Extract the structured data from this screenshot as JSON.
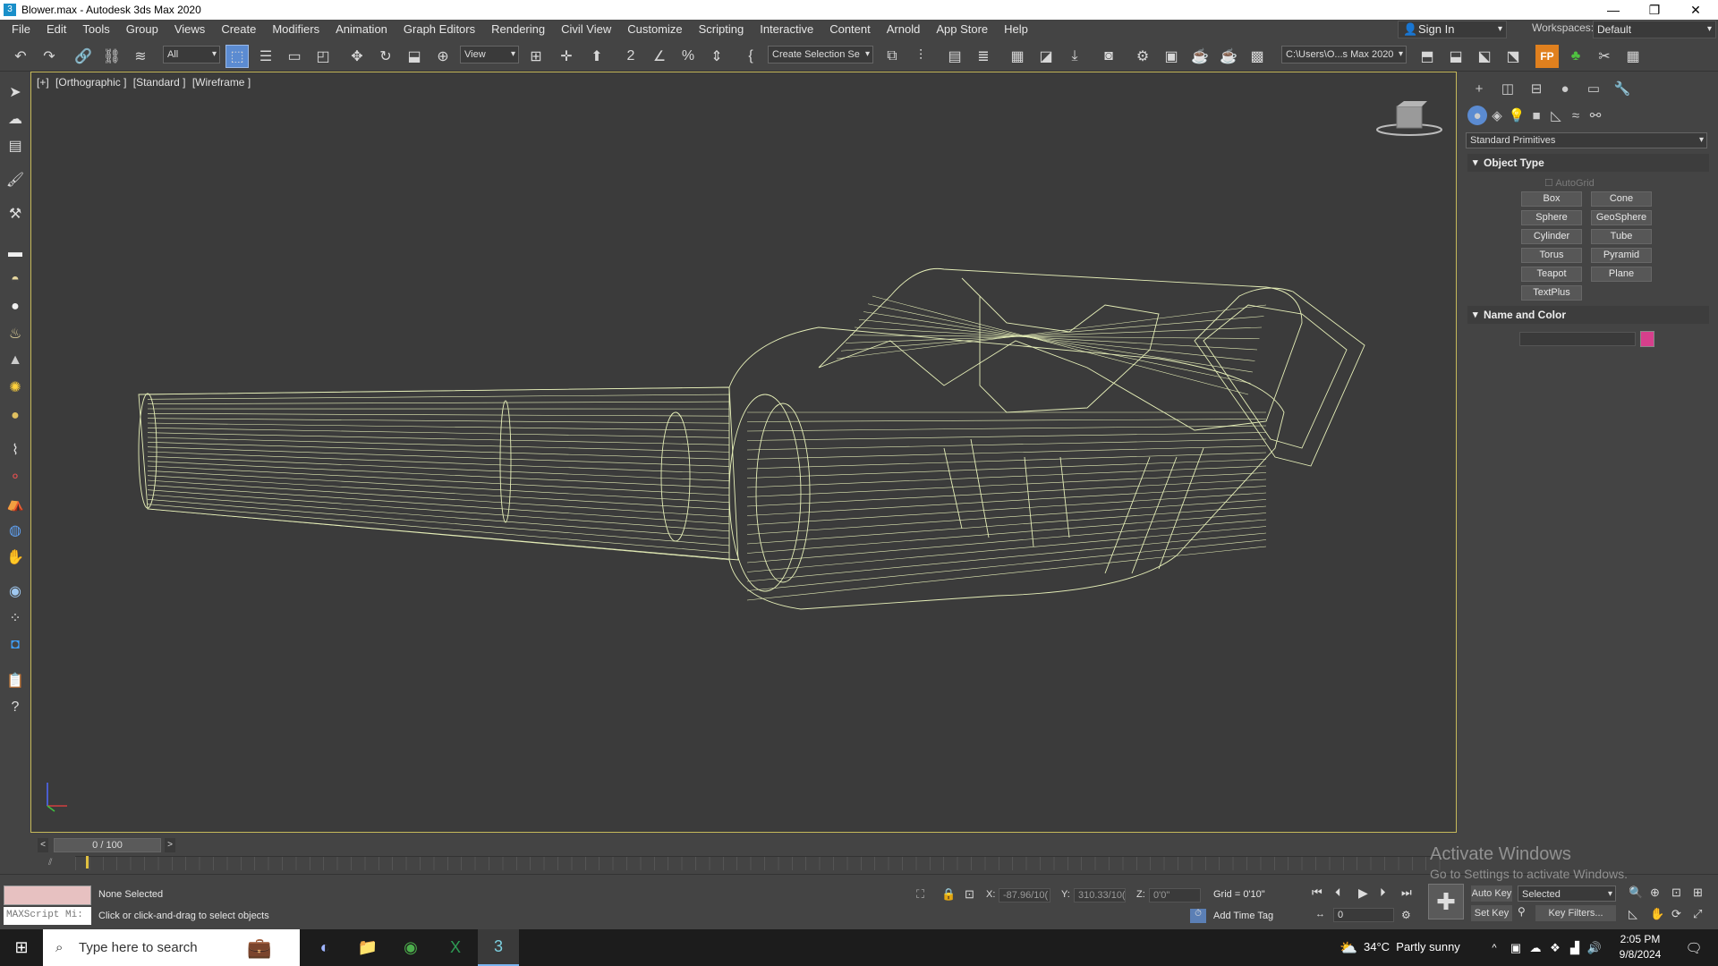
{
  "window": {
    "title": "Blower.max - Autodesk 3ds Max 2020",
    "minimize": "—",
    "maximize": "❐",
    "close": "✕"
  },
  "menu": [
    "File",
    "Edit",
    "Tools",
    "Group",
    "Views",
    "Create",
    "Modifiers",
    "Animation",
    "Graph Editors",
    "Rendering",
    "Civil View",
    "Customize",
    "Scripting",
    "Interactive",
    "Content",
    "Arnold",
    "App Store",
    "Help"
  ],
  "signin": "Sign In",
  "workspaces": {
    "label": "Workspaces:",
    "value": "Default"
  },
  "toolbar": {
    "filter": "All",
    "ref_coord": "View",
    "selection_set": "Create Selection Se",
    "project_path": "C:\\Users\\O...s Max 2020"
  },
  "viewport": {
    "labels": [
      "[+]",
      "[Orthographic ]",
      "[Standard ]",
      "[Wireframe ]"
    ],
    "wire_color": "#e6efb8",
    "border_color": "#c6b95a"
  },
  "command_panel": {
    "category": "Standard Primitives",
    "object_type_title": "Object Type",
    "autogrid": "AutoGrid",
    "primitives": [
      "Box",
      "Cone",
      "Sphere",
      "GeoSphere",
      "Cylinder",
      "Tube",
      "Torus",
      "Pyramid",
      "Teapot",
      "Plane",
      "TextPlus"
    ],
    "name_color_title": "Name and Color",
    "swatch_color": "#d63f8c"
  },
  "timeline": {
    "frame": "0 / 100"
  },
  "status": {
    "selection": "None Selected",
    "prompt": "Click or click-and-drag to select objects",
    "maxscript": "MAXScript Mi:",
    "x_label": "X:",
    "x_value": "-87.96/10(",
    "y_label": "Y:",
    "y_value": "310.33/10(",
    "z_label": "Z:",
    "z_value": "0'0\"",
    "grid": "Grid = 0'10\"",
    "add_time_tag": "Add Time Tag",
    "auto_key": "Auto Key",
    "set_key": "Set Key",
    "key_mode": "Selected",
    "key_filters": "Key Filters...",
    "current_frame": "0"
  },
  "activate_windows": {
    "title": "Activate Windows",
    "subtitle": "Go to Settings to activate Windows."
  },
  "taskbar": {
    "search_placeholder": "Type here to search",
    "weather": "34°C  Partly sunny",
    "time": "2:05 PM",
    "date": "9/8/2024"
  }
}
